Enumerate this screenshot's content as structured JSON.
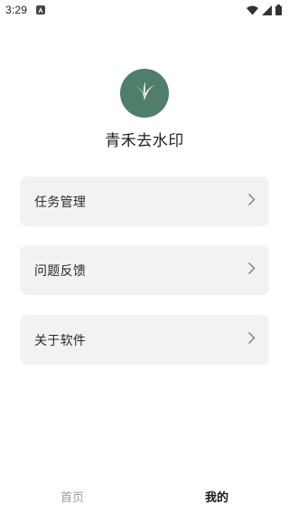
{
  "status_bar": {
    "time": "3:29",
    "icons": [
      "notification-a-icon",
      "wifi-icon",
      "signal-icon",
      "battery-icon"
    ]
  },
  "app": {
    "name": "青禾去水印",
    "logo_color": "#4f7f6a",
    "logo_icon": "sprout-icon"
  },
  "menu": {
    "items": [
      {
        "label": "任务管理",
        "icon": "chevron-right-icon"
      },
      {
        "label": "问题反馈",
        "icon": "chevron-right-icon"
      },
      {
        "label": "关于软件",
        "icon": "chevron-right-icon"
      }
    ],
    "card_color": "#f2f2f2"
  },
  "tabs": [
    {
      "label": "首页",
      "active": false
    },
    {
      "label": "我的",
      "active": true
    }
  ]
}
